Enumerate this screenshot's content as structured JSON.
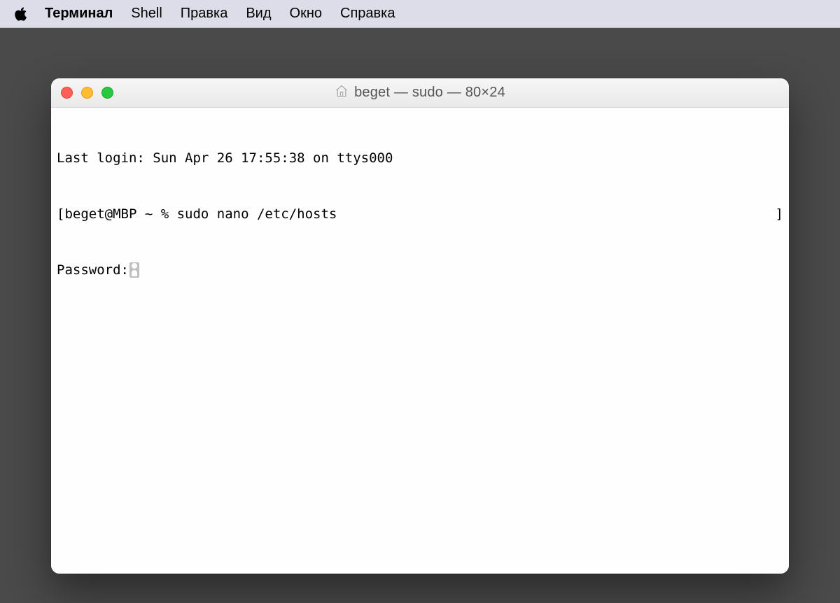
{
  "menubar": {
    "app_name": "Терминал",
    "items": [
      "Shell",
      "Правка",
      "Вид",
      "Окно",
      "Справка"
    ]
  },
  "window": {
    "title": "beget — sudo — 80×24"
  },
  "terminal": {
    "last_login": "Last login: Sun Apr 26 17:55:38 on ttys000",
    "prompt_left": "[beget@MBP ~ % sudo nano /etc/hosts",
    "prompt_right": "]",
    "password_label": "Password:"
  }
}
